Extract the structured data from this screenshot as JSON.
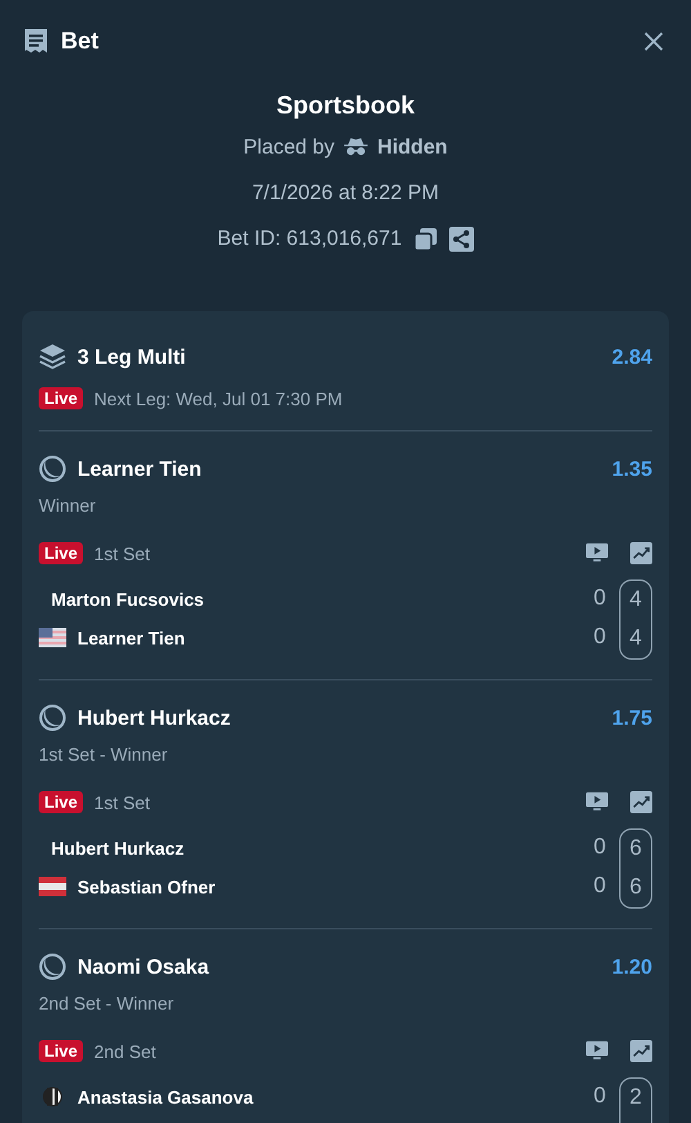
{
  "header": {
    "title": "Bet"
  },
  "summary": {
    "title": "Sportsbook",
    "placed_by_label": "Placed by",
    "placed_by_user": "Hidden",
    "placed_at": "7/1/2026 at 8:22 PM",
    "bet_id": "Bet ID: 613,016,671"
  },
  "multi": {
    "title": "3 Leg Multi",
    "odds": "2.84",
    "badge": "Live",
    "next_leg": "Next Leg: Wed, Jul 01 7:30 PM"
  },
  "legs": [
    {
      "selection": "Learner Tien",
      "odds": "1.35",
      "market": "Winner",
      "badge": "Live",
      "period": "1st Set",
      "players": [
        {
          "name": "Marton Fucsovics",
          "points": "0",
          "set": "4"
        },
        {
          "name": "Learner Tien",
          "flag": {
            "kind": "us"
          },
          "points": "0",
          "set": "4"
        }
      ]
    },
    {
      "selection": "Hubert Hurkacz",
      "odds": "1.75",
      "market": "1st Set - Winner",
      "badge": "Live",
      "period": "1st Set",
      "players": [
        {
          "name": "Hubert Hurkacz",
          "points": "0",
          "set": "6"
        },
        {
          "name": "Sebastian Ofner",
          "flag": {
            "kind": "at"
          },
          "points": "0",
          "set": "6"
        }
      ]
    },
    {
      "selection": "Naomi Osaka",
      "odds": "1.20",
      "market": "2nd Set - Winner",
      "badge": "Live",
      "period": "2nd Set",
      "players": [
        {
          "name": "Anastasia Gasanova",
          "flag": {
            "kind": "split"
          },
          "points": "0",
          "set": "2"
        }
      ]
    }
  ]
}
